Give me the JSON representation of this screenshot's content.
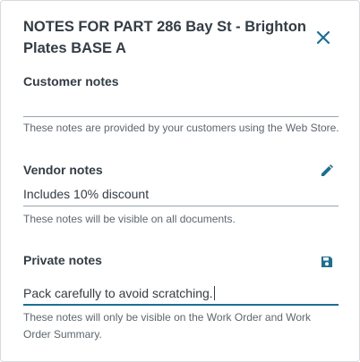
{
  "dialog": {
    "title": "NOTES FOR PART 286 Bay St - Brighton Plates BASE A",
    "close_icon": "close-icon"
  },
  "customer_notes": {
    "label": "Customer notes",
    "value": "",
    "hint": "These notes are provided by your customers using the Web Store."
  },
  "vendor_notes": {
    "label": "Vendor notes",
    "value": "Includes 10% discount",
    "hint": "These notes will be visible on all documents.",
    "action_icon": "pencil-icon"
  },
  "private_notes": {
    "label": "Private notes",
    "value": "Pack carefully to avoid scratching.",
    "hint": "These notes will only be visible on the Work Order and Work Order Summary.",
    "action_icon": "save-icon"
  },
  "colors": {
    "accent": "#1a6f95",
    "text": "#333d46",
    "hint": "#5c6770"
  }
}
